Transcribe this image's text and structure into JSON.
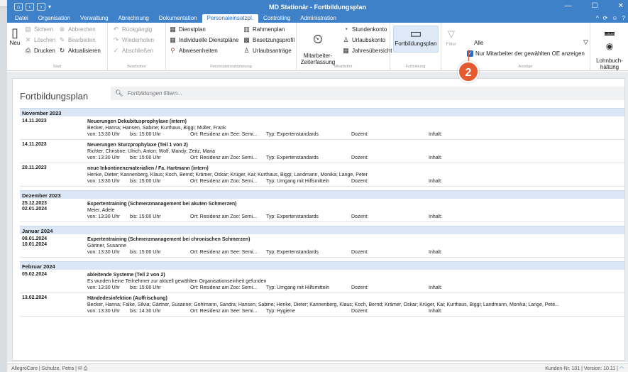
{
  "window": {
    "title": "MD Stationär - Fortbildungsplan",
    "controls": [
      "—",
      "☐",
      "✕"
    ]
  },
  "menu": {
    "items": [
      "Datei",
      "Organisation",
      "Verwaltung",
      "Abrechnung",
      "Dokumentation",
      "Personaleinsatzpl.",
      "Controlling",
      "Administration"
    ],
    "active_index": 5,
    "right_icons": [
      "^",
      "⟳",
      "☺",
      "?"
    ]
  },
  "ribbon": {
    "start": {
      "new_label": "Neu",
      "save": "Sichern",
      "cancel": "Abbrechen",
      "delete": "Löschen",
      "edit": "Bearbeiten",
      "print": "Drucken",
      "refresh": "Aktualisieren",
      "group_label": "Start"
    },
    "bearbeiten": {
      "undo": "Rückgängig",
      "redo": "Wiederholen",
      "finish": "Abschließen",
      "group_label": "Bearbeiten"
    },
    "personaleinsatz": {
      "dienstplan": "Dienstplan",
      "individuelle": "Individuelle Dienstpläne",
      "abwesenheiten": "Abwesenheiten",
      "rahmenplan": "Rahmenplan",
      "besetzungsprofil": "Besetzungsprofil",
      "urlaubsantraege": "Urlaubsanträge",
      "group_label": "Personaleinsatzplanung"
    },
    "mitarbeiter": {
      "zeiterfassung": "Mitarbeiter-\nZeiterfassung",
      "stundenkonto": "Stundenkonto",
      "urlaubskonto": "Urlaubskonto",
      "jahresuebersicht": "Jahresübersicht",
      "group_label": "Mitarbeiter"
    },
    "fortbildung": {
      "label": "Fortbildungsplan",
      "group_label": "Fortbildung"
    },
    "filter": {
      "label": "Filter"
    },
    "anzeige": {
      "selected": "Alle",
      "checkbox_label": "Nur Mitarbeiter der gewählten OE anzeigen",
      "checked": true,
      "group_label": "Anzeige"
    },
    "export": {
      "label": "Lohnbuch-\nhaltung",
      "logo": "LODAS",
      "group_label": "Export"
    }
  },
  "badge": "2",
  "page": {
    "title": "Fortbildungsplan",
    "search_placeholder": "Fortbildungen filtern..."
  },
  "months": [
    {
      "name": "November 2023",
      "entries": [
        {
          "date1": "14.11.2023",
          "date2": "",
          "title": "Neuerungen Dekubitusprophylaxe (intern)",
          "participants": "Becker, Hanna; Hansen, Sabine; Kurthaus, Biggi; Müller, Frank",
          "von": "von: 13:30 Uhr",
          "bis": "bis: 15:00 Uhr",
          "ort": "Ort: Residenz am See: Semi...",
          "typ": "Typ: Expertenstandards",
          "dozent": "Dozent:",
          "inhalt": "Inhalt:"
        },
        {
          "date1": "14.11.2023",
          "date2": "",
          "title": "Neuerungen Sturzprophylaxe (Teil 1 von 2)",
          "participants": "Richter, Christine; Ulrich, Anton; Wolf, Mandy; Zeitz, Maria",
          "von": "von: 13:30 Uhr",
          "bis": "bis: 15:00 Uhr",
          "ort": "Ort: Residenz am Zoo: Semi...",
          "typ": "Typ: Expertenstandards",
          "dozent": "Dozent:",
          "inhalt": "Inhalt:"
        },
        {
          "date1": "20.11.2023",
          "date2": "",
          "title": "neue Inkontinenzmaterialien / Fa. Hartmann (intern)",
          "participants": "Henke, Dieter; Kannenberg, Klaus; Koch, Bernd; Krämer, Oskar; Krüger, Kai; Kurthaus, Biggi; Landmann, Monika; Lange, Peter",
          "von": "von: 13:30 Uhr",
          "bis": "bis: 15:00 Uhr",
          "ort": "Ort: Residenz am Zoo: Semi...",
          "typ": "Typ: Umgang mit Hilfsmitteln",
          "dozent": "Dozent:",
          "inhalt": "Inhalt:"
        }
      ]
    },
    {
      "name": "Dezember 2023",
      "entries": [
        {
          "date1": "25.12.2023",
          "date2": "02.01.2024",
          "title": "Expertentraining (Schmerzmanagement bei akuten Schmerzen)",
          "participants": "Meier, Adele",
          "von": "von: 13:30 Uhr",
          "bis": "bis: 15:00 Uhr",
          "ort": "Ort: Residenz am Zoo: Semi...",
          "typ": "Typ: Expertenstandards",
          "dozent": "Dozent:",
          "inhalt": "Inhalt:"
        }
      ]
    },
    {
      "name": "Januar 2024",
      "entries": [
        {
          "date1": "08.01.2024",
          "date2": "10.01.2024",
          "title": "Expertentraining (Schmerzmanagement bei chronischen Schmerzen)",
          "participants": "Gärtner, Susanne",
          "von": "von: 13:30 Uhr",
          "bis": "bis: 15:00 Uhr",
          "ort": "Ort: Residenz am See: Semi...",
          "typ": "Typ: Expertenstandards",
          "dozent": "Dozent:",
          "inhalt": "Inhalt:"
        }
      ]
    },
    {
      "name": "Februar 2024",
      "entries": [
        {
          "date1": "05.02.2024",
          "date2": "",
          "title": "ableitende Systeme (Teil 2 von 2)",
          "participants": "Es wurden keine Teilnehmer zur aktuell gewählten Organisationseinheit gefunden",
          "von": "von: 13:30 Uhr",
          "bis": "bis: 15:00 Uhr",
          "ort": "Ort: Residenz am Zoo: Semi...",
          "typ": "Typ: Umgang mit Hilfsmitteln",
          "dozent": "Dozent:",
          "inhalt": "Inhalt:"
        },
        {
          "date1": "13.02.2024",
          "date2": "",
          "title": "Händedesinfektion (Auffrischung)",
          "participants": "Becker, Hanna; Falke, Silvia; Gärtner, Susanne; Gohlmann, Sandra; Hansen, Sabine; Henke, Dieter; Kannenberg, Klaus; Koch, Bernd; Krämer, Oskar; Krüger, Kai; Kurthaus, Biggi; Landmann, Monika; Lange, Pete...",
          "von": "von: 13:30 Uhr",
          "bis": "bis: 14:30 Uhr",
          "ort": "Ort: Residenz am See: Semi...",
          "typ": "Typ: Hygiene",
          "dozent": "Dozent:",
          "inhalt": "Inhalt:"
        }
      ]
    }
  ],
  "statusbar": {
    "left": "AllegroCare | Schulze, Petra |",
    "right": "Kunden-Nr. 101 | Version: 10.11 |"
  },
  "colors": {
    "titlebar": "#3f81c8",
    "month_header": "#dbe7f4",
    "badge": "#e55a2f",
    "checkbox": "#2a6cbf"
  }
}
